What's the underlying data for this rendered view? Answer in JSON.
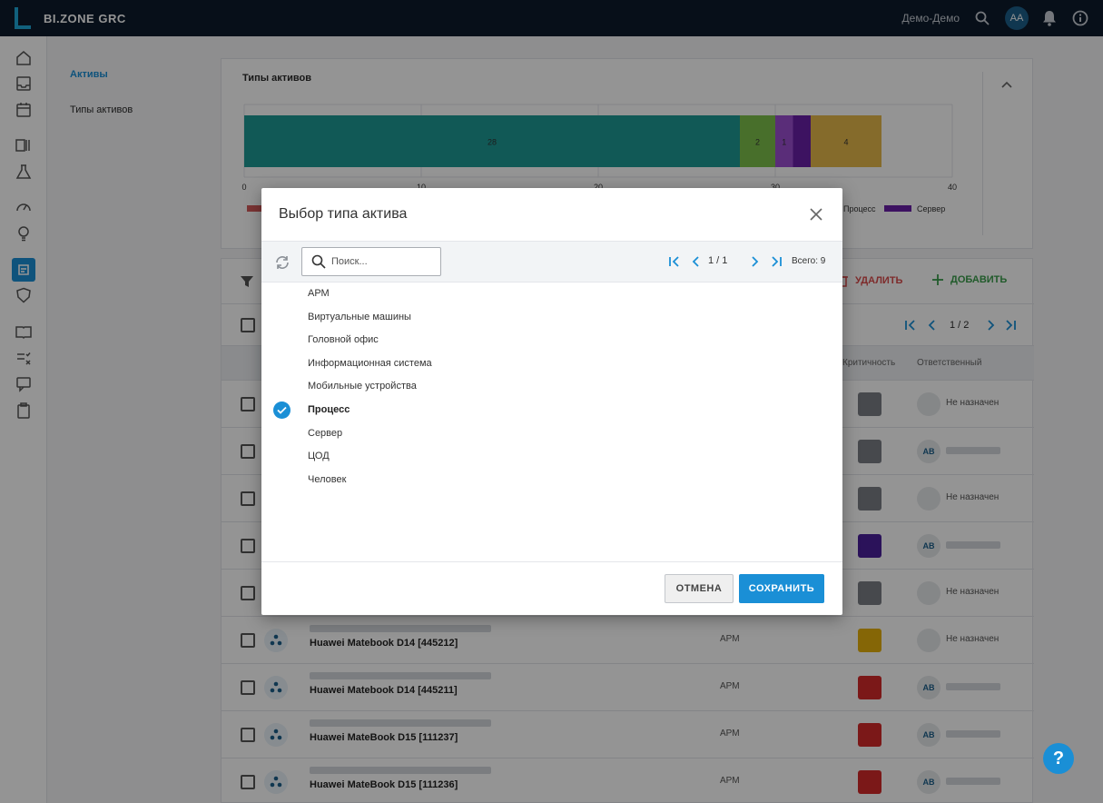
{
  "app": {
    "logo_text": "BI.ZONE GRC",
    "user_name": "Демо-Демо",
    "user_initials": "АА"
  },
  "subnav": {
    "items": [
      {
        "label": "Активы",
        "active": true
      },
      {
        "label": "Типы активов",
        "active": false
      }
    ]
  },
  "chart_card": {
    "title": "Типы активов"
  },
  "chart_data": {
    "type": "bar",
    "orientation": "horizontal-stacked",
    "title": "Типы активов",
    "xlim": [
      0,
      40
    ],
    "x_ticks": [
      "0",
      "10",
      "20",
      "30",
      "40"
    ],
    "series": [
      {
        "name": "",
        "value": 28,
        "color": "#1e9a95"
      },
      {
        "name": "",
        "value": 2,
        "color": "#7cc04a"
      },
      {
        "name": "",
        "value": 1,
        "color": "#9b4fd1"
      },
      {
        "name": "Процесс",
        "value": 1,
        "color": "#6a1fa8"
      },
      {
        "name": "",
        "value": 4,
        "color": "#e6b84a"
      }
    ],
    "data_labels": [
      "28",
      "2",
      "1",
      "",
      "4"
    ],
    "legend_visible": [
      "Процесс",
      "Сервер"
    ],
    "legend_colors": {
      "Сервер": "#6a1fa8"
    },
    "legend_position": "bottom"
  },
  "toolbar": {
    "delete_label": "УДАЛИТЬ",
    "add_label": "ДОБАВИТЬ",
    "pager_label": "1 / 2"
  },
  "table": {
    "columns": [
      "Критичность",
      "Ответственный"
    ],
    "rows": [
      {
        "name": "",
        "type": "",
        "crit_color": "#7b7f86",
        "resp_initials": "",
        "resp": "Не назначен"
      },
      {
        "name": "",
        "type": "",
        "crit_color": "#7b7f86",
        "resp_initials": "АВ",
        "resp": ""
      },
      {
        "name": "",
        "type": "",
        "crit_color": "#7b7f86",
        "resp_initials": "",
        "resp": "Не назначен"
      },
      {
        "name": "",
        "type": "",
        "crit_color": "#4a1f9c",
        "resp_initials": "АВ",
        "resp": ""
      },
      {
        "name": "",
        "type": "",
        "crit_color": "#7b7f86",
        "resp_initials": "",
        "resp": "Не назначен"
      },
      {
        "name": "Huawei Matebook D14 [445212]",
        "type": "АРМ",
        "crit_color": "#e5b00b",
        "resp_initials": "",
        "resp": "Не назначен"
      },
      {
        "name": "Huawei Matebook D14 [445211]",
        "type": "АРМ",
        "crit_color": "#d42a2a",
        "resp_initials": "АВ",
        "resp": ""
      },
      {
        "name": "Huawei MateBook D15 [111237]",
        "type": "АРМ",
        "crit_color": "#d42a2a",
        "resp_initials": "АВ",
        "resp": ""
      },
      {
        "name": "Huawei MateBook D15 [111236]",
        "type": "АРМ",
        "crit_color": "#d42a2a",
        "resp_initials": "АВ",
        "resp": ""
      }
    ]
  },
  "modal": {
    "title": "Выбор типа актива",
    "search_placeholder": "Поиск...",
    "pager_label": "1 / 1",
    "total_label": "Всего: 9",
    "items": [
      {
        "label": "АРМ",
        "selected": false
      },
      {
        "label": "Виртуальные машины",
        "selected": false
      },
      {
        "label": "Головной офис",
        "selected": false
      },
      {
        "label": "Информационная система",
        "selected": false
      },
      {
        "label": "Мобильные устройства",
        "selected": false
      },
      {
        "label": "Процесс",
        "selected": true
      },
      {
        "label": "Сервер",
        "selected": false
      },
      {
        "label": "ЦОД",
        "selected": false
      },
      {
        "label": "Человек",
        "selected": false
      }
    ],
    "cancel_label": "ОТМЕНА",
    "save_label": "СОХРАНИТЬ"
  },
  "help_label": "?"
}
